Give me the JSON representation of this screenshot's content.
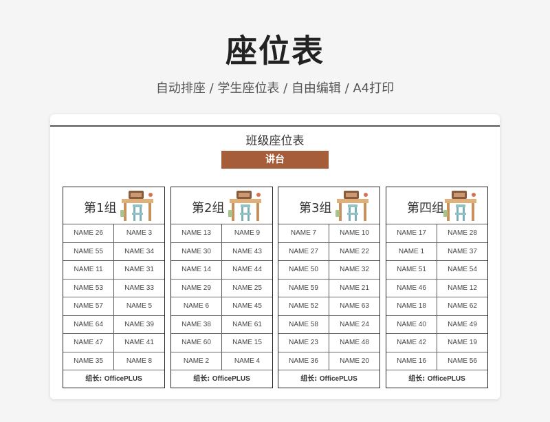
{
  "page": {
    "title": "座位表",
    "subtitle": "自动排座 / 学生座位表 / 自由编辑 / A4打印"
  },
  "sheet": {
    "title": "班级座位表",
    "podium_label": "讲台",
    "accent_color": "#a65e3a",
    "leader_label": "组长:",
    "groups": [
      {
        "name": "第1组",
        "leader": "OfficePLUS",
        "rows": [
          [
            "NAME 26",
            "NAME 3"
          ],
          [
            "NAME 55",
            "NAME 34"
          ],
          [
            "NAME 11",
            "NAME 31"
          ],
          [
            "NAME 53",
            "NAME 33"
          ],
          [
            "NAME 57",
            "NAME 5"
          ],
          [
            "NAME 64",
            "NAME 39"
          ],
          [
            "NAME 47",
            "NAME 41"
          ],
          [
            "NAME 35",
            "NAME 8"
          ]
        ]
      },
      {
        "name": "第2组",
        "leader": "OfficePLUS",
        "rows": [
          [
            "NAME 13",
            "NAME 9"
          ],
          [
            "NAME 30",
            "NAME 43"
          ],
          [
            "NAME 14",
            "NAME 44"
          ],
          [
            "NAME 29",
            "NAME 25"
          ],
          [
            "NAME 6",
            "NAME 45"
          ],
          [
            "NAME 38",
            "NAME 61"
          ],
          [
            "NAME 60",
            "NAME 15"
          ],
          [
            "NAME 2",
            "NAME 4"
          ]
        ]
      },
      {
        "name": "第3组",
        "leader": "OfficePLUS",
        "rows": [
          [
            "NAME 7",
            "NAME 10"
          ],
          [
            "NAME 27",
            "NAME 22"
          ],
          [
            "NAME 50",
            "NAME 32"
          ],
          [
            "NAME 59",
            "NAME 21"
          ],
          [
            "NAME 52",
            "NAME 63"
          ],
          [
            "NAME 58",
            "NAME 24"
          ],
          [
            "NAME 23",
            "NAME 48"
          ],
          [
            "NAME 36",
            "NAME 20"
          ]
        ]
      },
      {
        "name": "第四组",
        "leader": "OfficePLUS",
        "rows": [
          [
            "NAME 17",
            "NAME 28"
          ],
          [
            "NAME 1",
            "NAME 37"
          ],
          [
            "NAME 51",
            "NAME 54"
          ],
          [
            "NAME 46",
            "NAME 12"
          ],
          [
            "NAME 18",
            "NAME 62"
          ],
          [
            "NAME 40",
            "NAME 49"
          ],
          [
            "NAME 42",
            "NAME 19"
          ],
          [
            "NAME 16",
            "NAME 56"
          ]
        ]
      }
    ]
  }
}
